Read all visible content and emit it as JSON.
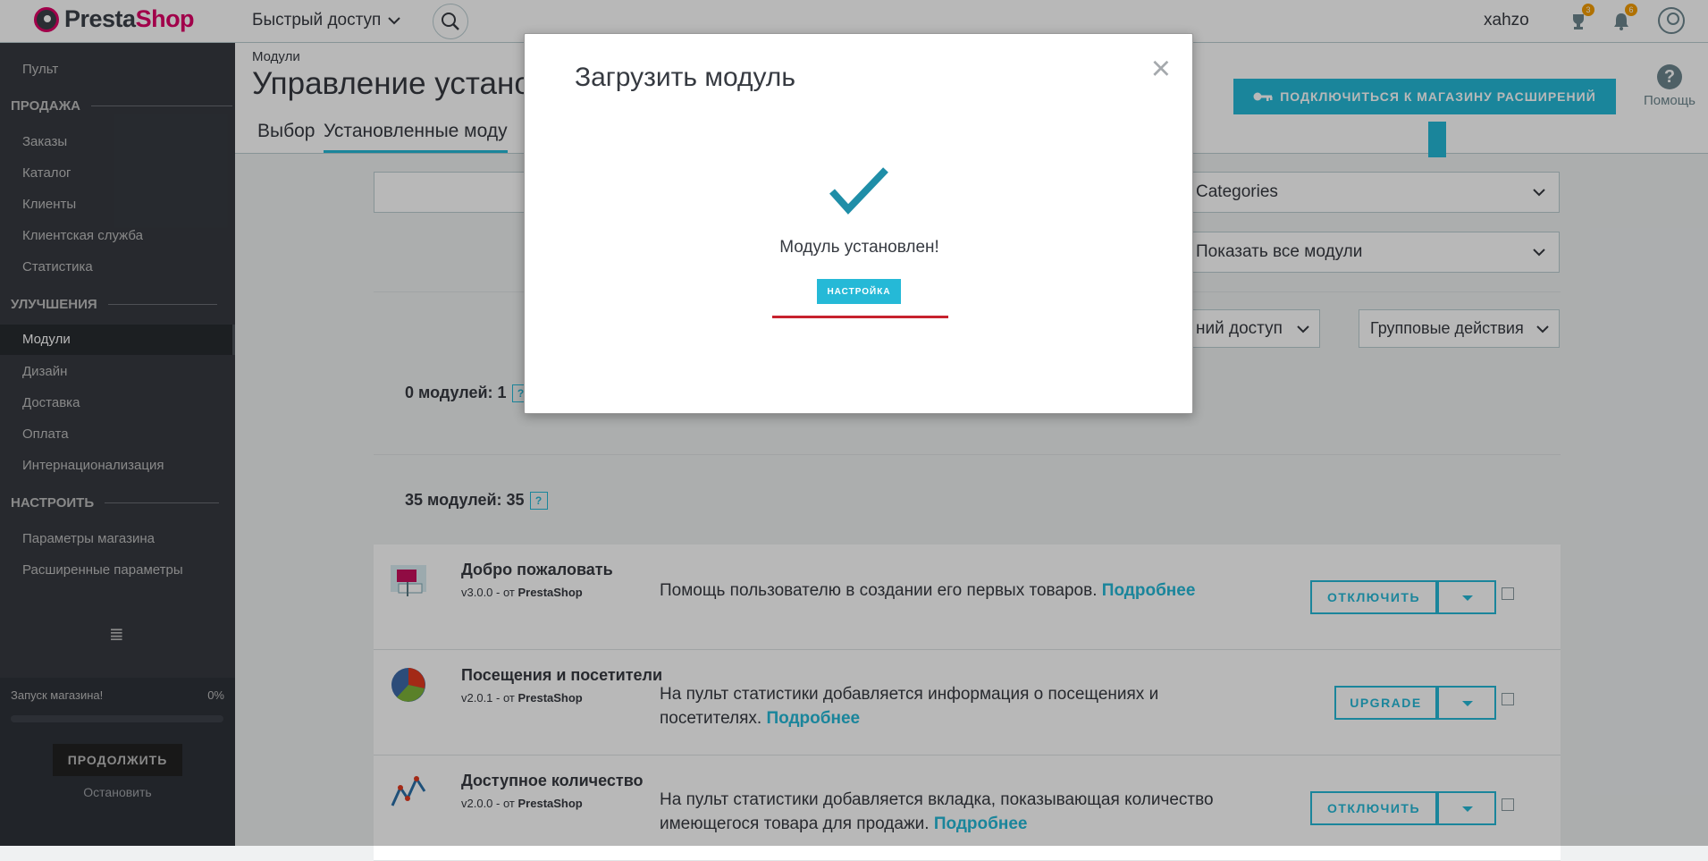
{
  "topbar": {
    "logo_main": "Presta",
    "logo_accent": "Shop",
    "quick_access": "Быстрый доступ",
    "user": "xahzo",
    "orders_badge": "3",
    "notif_badge": "6"
  },
  "sidebar": {
    "dashboard": "Пульт",
    "section_sell": "ПРОДАЖА",
    "sell_items": [
      "Заказы",
      "Каталог",
      "Клиенты",
      "Клиентская служба",
      "Статистика"
    ],
    "section_improve": "УЛУЧШЕНИЯ",
    "improve_items": [
      "Модули",
      "Дизайн",
      "Доставка",
      "Оплата",
      "Интернационализация"
    ],
    "section_configure": "НАСТРОИТЬ",
    "configure_items": [
      "Параметры магазина",
      "Расширенные параметры"
    ],
    "launch_label": "Запуск магазина!",
    "launch_percent": "0%",
    "launch_progress": 0,
    "continue_label": "ПРОДОЛЖИТЬ",
    "stop_label": "Остановить"
  },
  "header": {
    "breadcrumb": "Модули",
    "title": "Управление установ",
    "tab_selection": "Выбор",
    "tab_installed": "Установленные моду",
    "connect_label": "ПОДКЛЮЧИТЬСЯ К МАГАЗИНУ РАСШИРЕНИЙ",
    "help_label": "Помощь"
  },
  "filters": {
    "categories": "Categories",
    "show_all": "Показать все модули",
    "quick_access": "ний доступ",
    "bulk_actions": "Групповые действия"
  },
  "counts": {
    "upgrade": "0 модулей: 1",
    "installed": "35 модулей: 35",
    "help_mark": "?"
  },
  "modules": [
    {
      "name": "Добро пожаловать",
      "version": "v3.0.0 - от",
      "author": "PrestaShop",
      "description": "Помощь пользователю в создании его первых товаров.",
      "more": "Подробнее",
      "action": "ОТКЛЮЧИТЬ"
    },
    {
      "name": "Посещения и посетители",
      "version": "v2.0.1 - от",
      "author": "PrestaShop",
      "description": "На пульт статистики добавляется информация о посещениях и посетителях.",
      "more": "Подробнее",
      "action": "UPGRADE"
    },
    {
      "name": "Доступное количество",
      "version": "v2.0.0 - от",
      "author": "PrestaShop",
      "description": "На пульт статистики добавляется вкладка, показывающая количество имеющегося товара для продажи.",
      "more": "Подробнее",
      "action": "ОТКЛЮЧИТЬ"
    }
  ],
  "modal": {
    "title": "Загрузить модуль",
    "close": "×",
    "success": "Модуль установлен!",
    "config_button": "НАСТРОЙКА"
  },
  "colors": {
    "accent": "#25b9d7",
    "sidebar": "#363a41",
    "brand": "#df0067",
    "check": "#1f8ea8",
    "error_line": "#c7222e"
  }
}
